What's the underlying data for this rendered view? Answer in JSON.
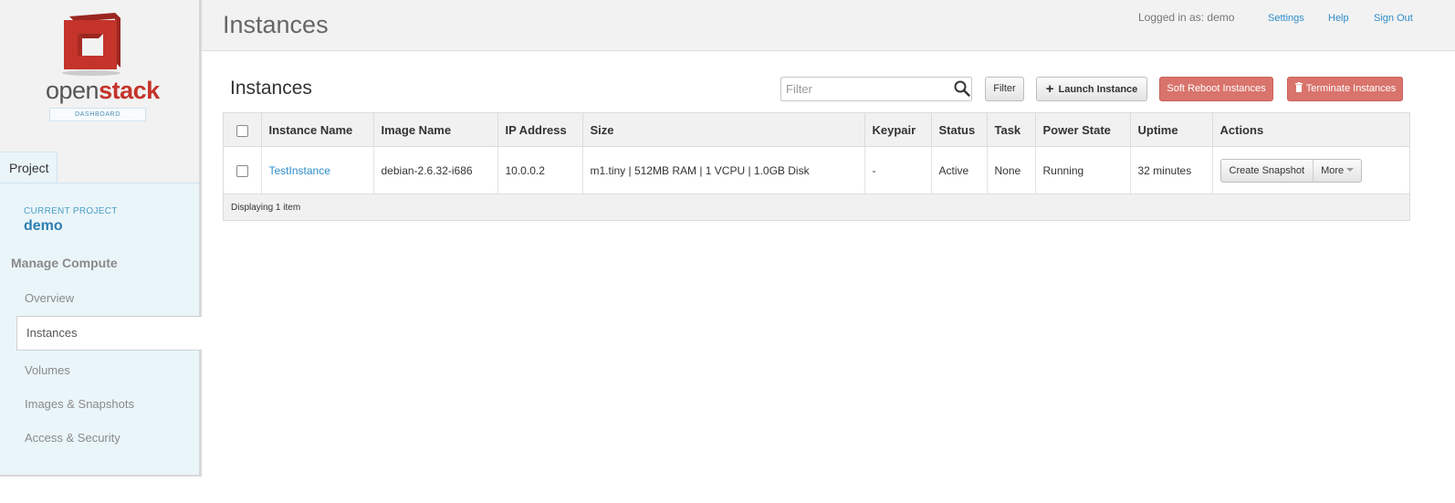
{
  "brand": {
    "name_part1": "open",
    "name_part2": "stack",
    "subtitle": "DASHBOARD",
    "colors": {
      "red": "#c4342b",
      "red_dark": "#9b2620"
    }
  },
  "sidebar": {
    "project_tab": "Project",
    "current_project_label": "CURRENT PROJECT",
    "current_project_name": "demo",
    "section_heading": "Manage Compute",
    "items": [
      {
        "label": "Overview",
        "active": false
      },
      {
        "label": "Instances",
        "active": true
      },
      {
        "label": "Volumes",
        "active": false
      },
      {
        "label": "Images & Snapshots",
        "active": false
      },
      {
        "label": "Access & Security",
        "active": false
      }
    ]
  },
  "header": {
    "title": "Instances",
    "logged_in": "Logged in as: demo",
    "links": [
      "Settings",
      "Help",
      "Sign Out"
    ]
  },
  "main": {
    "title": "Instances",
    "filter_placeholder": "Filter",
    "filter_button": "Filter",
    "launch_button": "Launch Instance",
    "soft_reboot_button": "Soft Reboot Instances",
    "terminate_button": "Terminate Instances",
    "table": {
      "columns": [
        "Instance Name",
        "Image Name",
        "IP Address",
        "Size",
        "Keypair",
        "Status",
        "Task",
        "Power State",
        "Uptime",
        "Actions"
      ],
      "rows": [
        {
          "instance_name": "TestInstance",
          "image_name": "debian-2.6.32-i686",
          "ip_address": "10.0.0.2",
          "size": "m1.tiny | 512MB RAM | 1 VCPU | 1.0GB Disk",
          "keypair": "-",
          "status": "Active",
          "task": "None",
          "power_state": "Running",
          "uptime": "32 minutes",
          "action_primary": "Create Snapshot",
          "action_more": "More"
        }
      ],
      "footer": "Displaying 1 item"
    }
  },
  "icons": {
    "search": "search-icon",
    "plus": "plus-icon",
    "trash": "trash-icon",
    "caret": "caret-down-icon",
    "logo": "openstack-logo-icon"
  }
}
